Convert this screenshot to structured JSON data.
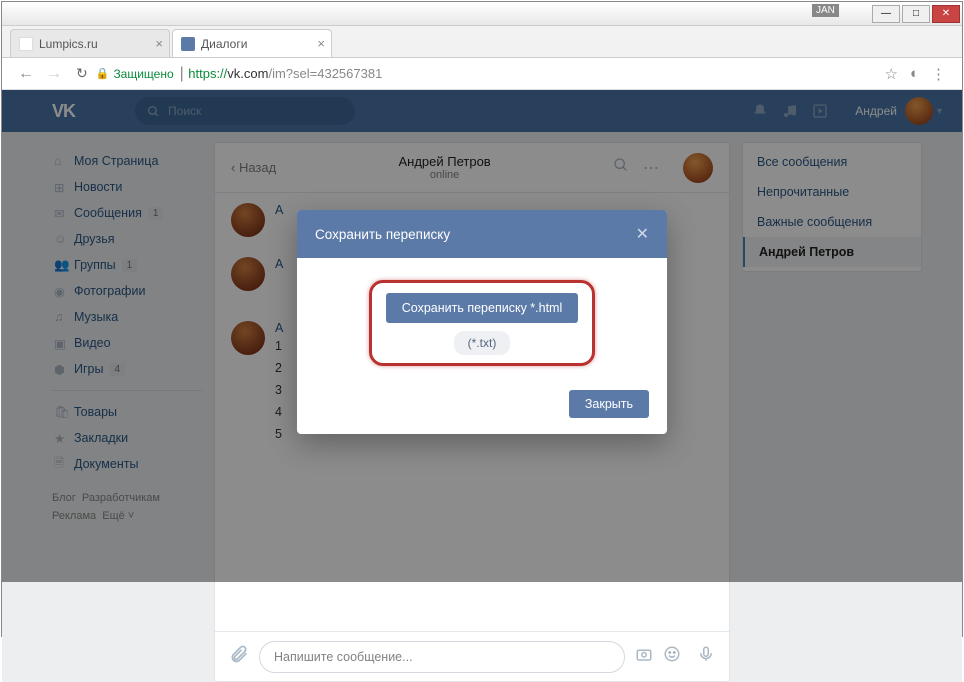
{
  "window": {
    "jan": "JAN"
  },
  "tabs": [
    {
      "title": "Lumpics.ru"
    },
    {
      "title": "Диалоги"
    }
  ],
  "address": {
    "secure_label": "Защищено",
    "scheme": "https://",
    "host": "vk.com",
    "path": "/im?sel=432567381"
  },
  "vk_header": {
    "logo": "VK",
    "search_placeholder": "Поиск",
    "username": "Андрей"
  },
  "sidebar": {
    "items": [
      {
        "label": "Моя Страница"
      },
      {
        "label": "Новости"
      },
      {
        "label": "Сообщения",
        "badge": "1"
      },
      {
        "label": "Друзья"
      },
      {
        "label": "Группы",
        "badge": "1"
      },
      {
        "label": "Фотографии"
      },
      {
        "label": "Музыка"
      },
      {
        "label": "Видео"
      },
      {
        "label": "Игры",
        "badge": "4"
      }
    ],
    "items2": [
      {
        "label": "Товары"
      },
      {
        "label": "Закладки"
      },
      {
        "label": "Документы"
      }
    ],
    "footer": {
      "line1a": "Блог",
      "line1b": "Разработчикам",
      "line2a": "Реклама",
      "line2b": "Ещё"
    }
  },
  "chat": {
    "back": "Назад",
    "peer_name": "Андрей Петров",
    "peer_status": "online",
    "author_partial": "А",
    "lines": [
      "1",
      "2",
      "3",
      "4",
      "5"
    ],
    "composer_placeholder": "Напишите сообщение..."
  },
  "right_panel": {
    "items": [
      "Все сообщения",
      "Непрочитанные",
      "Важные сообщения",
      "Андрей Петров"
    ]
  },
  "modal": {
    "title": "Сохранить переписку",
    "save_html": "Сохранить переписку *.html",
    "save_txt": "(*.txt)",
    "close": "Закрыть"
  }
}
